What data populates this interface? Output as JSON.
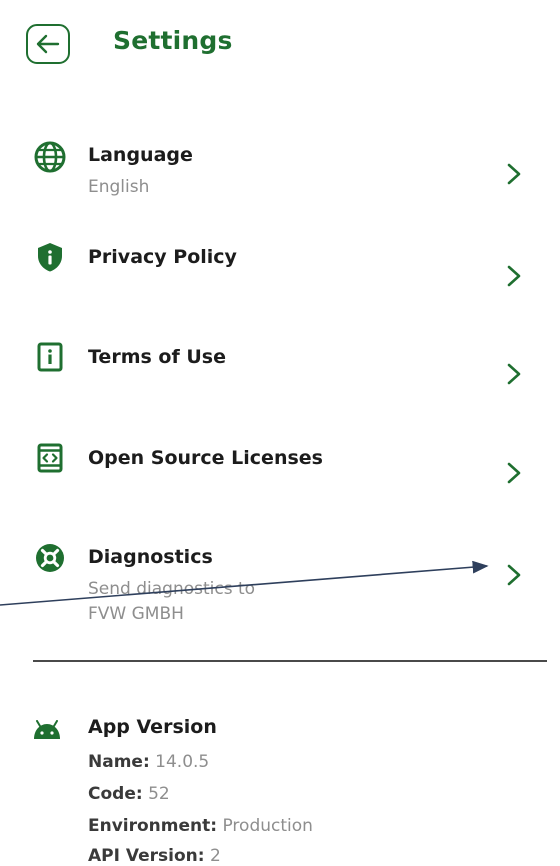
{
  "header": {
    "title": "Settings",
    "back_icon": "arrow-left-icon"
  },
  "colors": {
    "accent": "#1f6f30",
    "text": "#1c1c1c",
    "muted": "#8e8e8e"
  },
  "items": [
    {
      "label": "Language",
      "sub": "English",
      "icon": "globe-icon"
    },
    {
      "label": "Privacy Policy",
      "icon": "shield-icon"
    },
    {
      "label": "Terms of Use",
      "icon": "info-document-icon"
    },
    {
      "label": "Open Source Licenses",
      "icon": "code-document-icon"
    },
    {
      "label": "Diagnostics",
      "sub_line1": "Send diagnostics to",
      "sub_line2": "FVW GMBH",
      "icon": "lifebuoy-icon"
    }
  ],
  "version": {
    "title": "App Version",
    "icon": "android-icon",
    "name_label": "Name:",
    "name_value": "14.0.5",
    "code_label": "Code:",
    "code_value": "52",
    "env_label": "Environment:",
    "env_value": "Production",
    "api_label": "API Version:",
    "api_value": "2"
  }
}
